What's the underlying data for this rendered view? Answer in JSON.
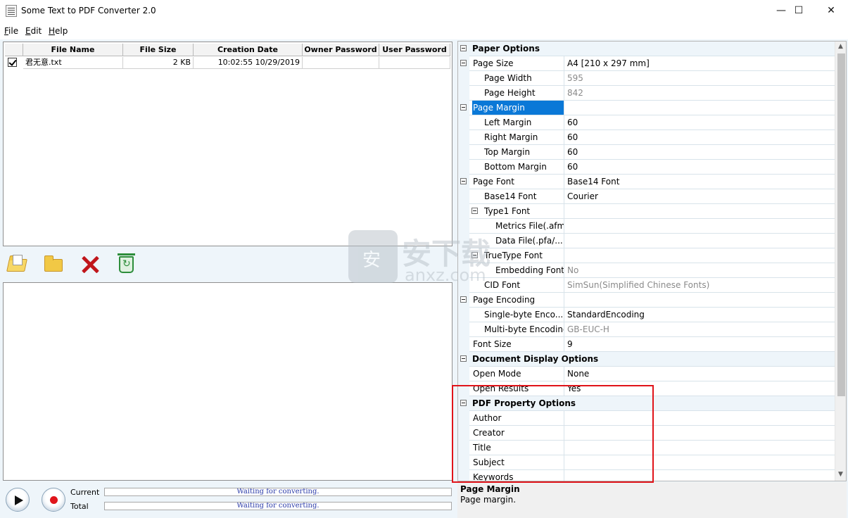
{
  "window": {
    "title": "Some Text to PDF Converter 2.0",
    "minimize": "—",
    "maximize": "☐",
    "close": "✕"
  },
  "menu": [
    {
      "key": "F",
      "rest": "ile"
    },
    {
      "key": "E",
      "rest": "dit"
    },
    {
      "key": "H",
      "rest": "elp"
    }
  ],
  "file_table": {
    "columns": [
      "File Name",
      "File Size",
      "Creation Date",
      "Owner Password",
      "User Password"
    ],
    "rows": [
      {
        "checked": true,
        "name": "君无意.txt",
        "size": "2 KB",
        "date": "10:02:55 10/29/2019",
        "owner_password": "",
        "user_password": ""
      }
    ]
  },
  "toolbar": {
    "icons": [
      "add-files-icon",
      "open-folder-icon",
      "delete-icon",
      "clear-recycle-icon"
    ]
  },
  "progress": {
    "current_label": "Current",
    "total_label": "Total",
    "current_text": "Waiting for converting.",
    "total_text": "Waiting for converting."
  },
  "properties": [
    {
      "name": "Paper Options",
      "cat": true
    },
    {
      "name": "Page Size",
      "value": "A4 [210 x 297 mm]",
      "toggle": true
    },
    {
      "name": "Page Width",
      "value": "595",
      "indent": 1,
      "gray": true
    },
    {
      "name": "Page Height",
      "value": "842",
      "indent": 1,
      "gray": true
    },
    {
      "name": "Page Margin",
      "value": "",
      "toggle": true,
      "selected": true
    },
    {
      "name": "Left Margin",
      "value": "60",
      "indent": 1
    },
    {
      "name": "Right Margin",
      "value": "60",
      "indent": 1
    },
    {
      "name": "Top Margin",
      "value": "60",
      "indent": 1
    },
    {
      "name": "Bottom Margin",
      "value": "60",
      "indent": 1
    },
    {
      "name": "Page Font",
      "value": "Base14 Font",
      "toggle": true
    },
    {
      "name": "Base14 Font",
      "value": "Courier",
      "indent": 1
    },
    {
      "name": "Type1 Font",
      "value": "",
      "indent": 1,
      "toggle": true
    },
    {
      "name": "Metrics File(.afm)",
      "value": "",
      "indent": 2
    },
    {
      "name": "Data File(.pfa/...",
      "value": "",
      "indent": 2
    },
    {
      "name": "TrueType Font",
      "value": "",
      "indent": 1,
      "toggle": true
    },
    {
      "name": "Embedding Font",
      "value": "No",
      "indent": 2,
      "gray": true
    },
    {
      "name": "CID Font",
      "value": "SimSun(Simplified Chinese Fonts)",
      "indent": 1,
      "gray": true
    },
    {
      "name": "Page Encoding",
      "value": "",
      "toggle": true
    },
    {
      "name": "Single-byte Enco...",
      "value": "StandardEncoding",
      "indent": 1
    },
    {
      "name": "Multi-byte Encoding",
      "value": "GB-EUC-H",
      "indent": 1,
      "gray": true
    },
    {
      "name": "Font Size",
      "value": "9"
    },
    {
      "name": "Document Display Options",
      "cat": true
    },
    {
      "name": "Open Mode",
      "value": "None"
    },
    {
      "name": "Open Results",
      "value": "Yes"
    },
    {
      "name": "PDF Property Options",
      "cat": true
    },
    {
      "name": "Author",
      "value": ""
    },
    {
      "name": "Creator",
      "value": ""
    },
    {
      "name": "Title",
      "value": ""
    },
    {
      "name": "Subject",
      "value": ""
    },
    {
      "name": "Keywords",
      "value": ""
    }
  ],
  "description": {
    "title": "Page Margin",
    "text": "Page margin."
  },
  "watermark": {
    "text": "安下载",
    "sub": "anxz.com"
  },
  "colors": {
    "selection": "#0a78d7",
    "highlight_box": "#e0141a",
    "panel_bg": "#eef5fa"
  }
}
